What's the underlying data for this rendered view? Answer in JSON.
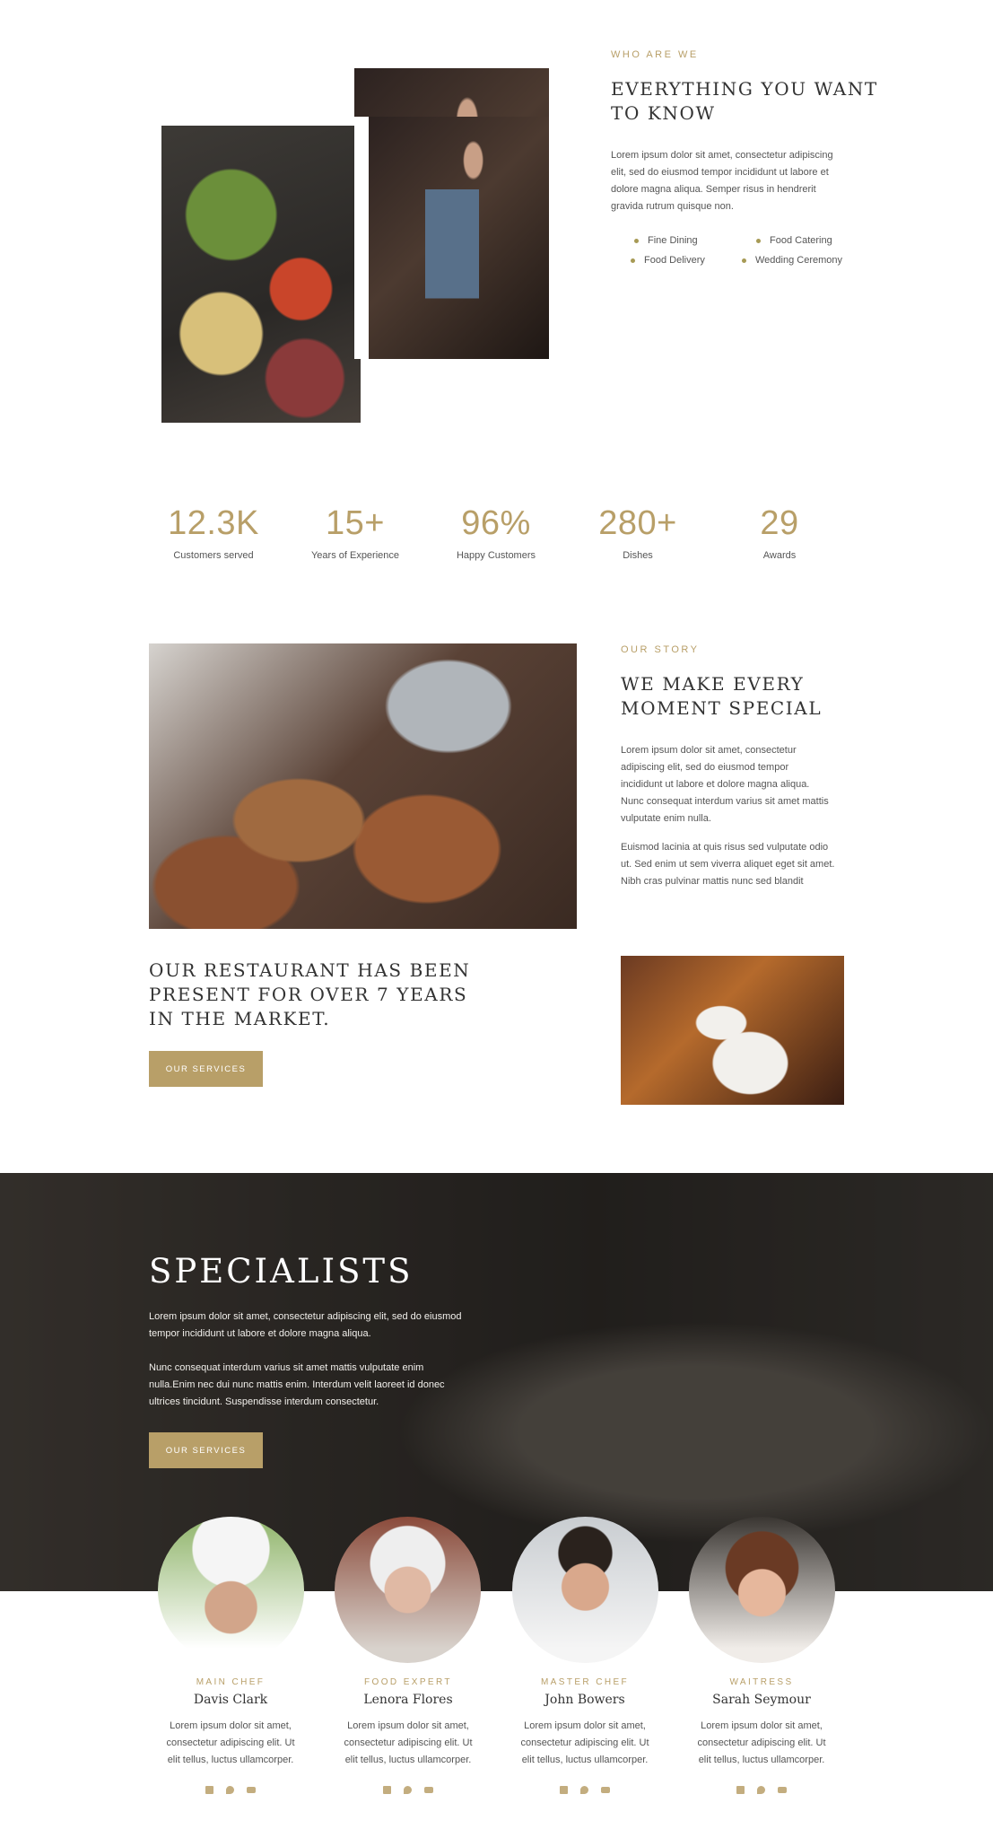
{
  "about": {
    "eyebrow": "WHO ARE WE",
    "title_line1": "EVERYTHING YOU WANT",
    "title_line2": "TO KNOW",
    "text_line1": "Lorem ipsum dolor sit amet, consectetur adipiscing",
    "text_line2": "elit, sed do eiusmod tempor incididunt ut labore et",
    "text_line3": "dolore magna aliqua. Semper risus in hendrerit",
    "text_line4": "gravida rutrum quisque non.",
    "services": [
      "Fine Dining",
      "Food Catering",
      "Food Delivery",
      "Wedding Ceremony"
    ]
  },
  "stats": [
    {
      "value": "12.3K",
      "label": "Customers served"
    },
    {
      "value": "15+",
      "label": "Years of Experience"
    },
    {
      "value": "96%",
      "label": "Happy Customers"
    },
    {
      "value": "280+",
      "label": "Dishes"
    },
    {
      "value": "29",
      "label": "Awards"
    }
  ],
  "story": {
    "eyebrow": "OUR STORY",
    "title_line1": "WE MAKE EVERY",
    "title_line2": "MOMENT SPECIAL",
    "p1_line1": "Lorem ipsum dolor sit amet, consectetur",
    "p1_line2": "adipiscing elit, sed do eiusmod tempor",
    "p1_line3": "incididunt ut labore et dolore magna aliqua.",
    "p1_line4": "Nunc consequat interdum varius sit amet mattis",
    "p1_line5": "vulputate enim nulla.",
    "p2_line1": "Euismod lacinia at quis risus sed vulputate odio",
    "p2_line2": "ut. Sed enim ut sem viverra aliquet eget sit amet.",
    "p2_line3": "Nibh cras pulvinar mattis nunc sed blandit",
    "present_line1": "OUR RESTAURANT HAS BEEN",
    "present_line2": "PRESENT FOR OVER 7 YEARS",
    "present_line3": "IN THE MARKET.",
    "button": "OUR SERVICES"
  },
  "specialists": {
    "title": "SPECIALISTS",
    "p1_line1": "Lorem ipsum dolor sit amet, consectetur adipiscing elit, sed do eiusmod",
    "p1_line2": "tempor incididunt ut labore et dolore magna aliqua.",
    "p2_line1": "Nunc consequat interdum varius sit amet mattis vulputate enim",
    "p2_line2": "nulla.Enim nec dui nunc mattis enim. Interdum velit laoreet id donec",
    "p2_line3": "ultrices tincidunt. Suspendisse interdum consectetur.",
    "button": "OUR SERVICES"
  },
  "team": [
    {
      "role": "MAIN CHEF",
      "name": "Davis Clark",
      "bio1": "Lorem ipsum dolor sit amet,",
      "bio2": "consectetur adipiscing elit. Ut",
      "bio3": "elit tellus, luctus ullamcorper."
    },
    {
      "role": "FOOD EXPERT",
      "name": "Lenora Flores",
      "bio1": "Lorem ipsum dolor sit amet,",
      "bio2": "consectetur adipiscing elit. Ut",
      "bio3": "elit tellus, luctus ullamcorper."
    },
    {
      "role": "MASTER CHEF",
      "name": "John Bowers",
      "bio1": "Lorem ipsum dolor sit amet,",
      "bio2": "consectetur adipiscing elit. Ut",
      "bio3": "elit tellus, luctus ullamcorper."
    },
    {
      "role": "WAITRESS",
      "name": "Sarah Seymour",
      "bio1": "Lorem ipsum dolor sit amet,",
      "bio2": "consectetur adipiscing elit. Ut",
      "bio3": "elit tellus, luctus ullamcorper."
    }
  ],
  "social_icons": [
    "facebook-icon",
    "twitter-icon",
    "youtube-icon"
  ],
  "colors": {
    "accent": "#b89f68",
    "heading": "#333333",
    "text": "#555555"
  }
}
